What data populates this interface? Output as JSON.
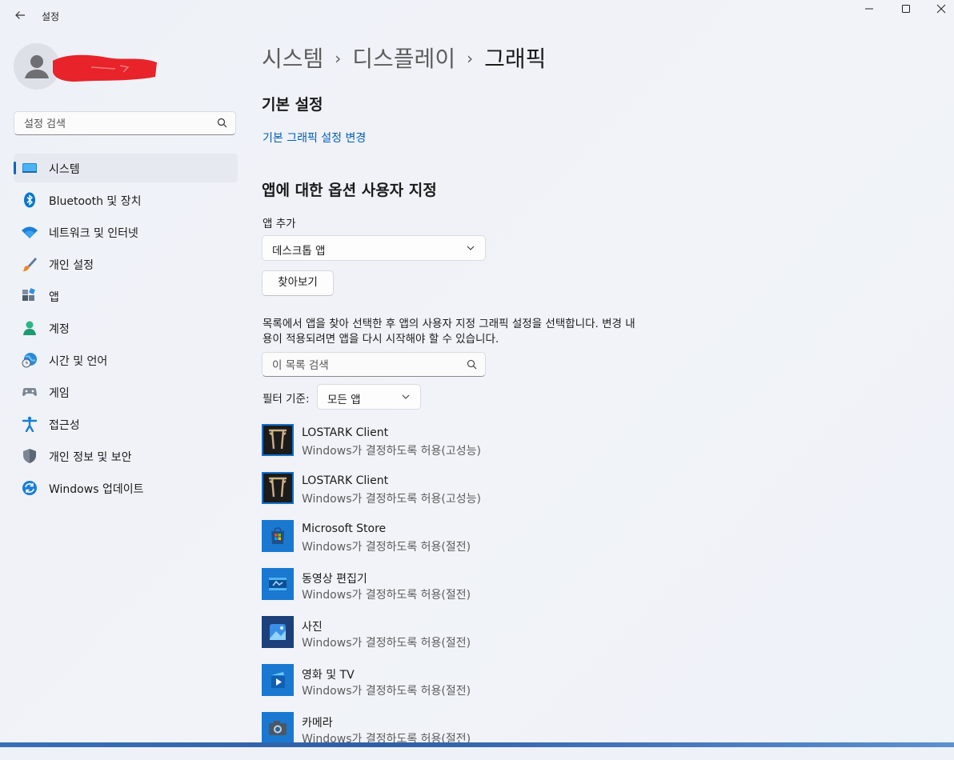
{
  "window": {
    "title": "설정",
    "back_icon": "back-arrow-icon",
    "controls": [
      "minimize-icon",
      "maximize-icon",
      "close-icon"
    ]
  },
  "search": {
    "placeholder": "설정 검색",
    "icon": "search-icon"
  },
  "sidebar": {
    "items": [
      {
        "label": "시스템",
        "icon": "monitor-icon",
        "active": true
      },
      {
        "label": "Bluetooth 및 장치",
        "icon": "bluetooth-icon",
        "active": false
      },
      {
        "label": "네트워크 및 인터넷",
        "icon": "wifi-icon",
        "active": false
      },
      {
        "label": "개인 설정",
        "icon": "brush-icon",
        "active": false
      },
      {
        "label": "앱",
        "icon": "apps-icon",
        "active": false
      },
      {
        "label": "계정",
        "icon": "person-icon",
        "active": false
      },
      {
        "label": "시간 및 언어",
        "icon": "globe-clock-icon",
        "active": false
      },
      {
        "label": "게임",
        "icon": "gamepad-icon",
        "active": false
      },
      {
        "label": "접근성",
        "icon": "accessibility-icon",
        "active": false
      },
      {
        "label": "개인 정보 및 보안",
        "icon": "shield-icon",
        "active": false
      },
      {
        "label": "Windows 업데이트",
        "icon": "update-icon",
        "active": false
      }
    ]
  },
  "breadcrumb": {
    "part1": "시스템",
    "part2": "디스플레이",
    "current": "그래픽",
    "separator": "›"
  },
  "main": {
    "basic_heading": "기본 설정",
    "basic_link": "기본 그래픽 설정 변경",
    "custom_heading": "앱에 대한 옵션 사용자 지정",
    "add_app_label": "앱 추가",
    "app_type_value": "데스크톱 앱",
    "browse_button": "찾아보기",
    "description": "목록에서 앱을 찾아 선택한 후 앱의 사용자 지정 그래픽 설정을 선택합니다. 변경 내용이 적용되려면 앱을 다시 시작해야 할 수 있습니다.",
    "list_search_placeholder": "이 목록 검색",
    "filter_label": "필터 기준:",
    "filter_value": "모든 앱"
  },
  "apps": [
    {
      "name": "LOSTARK Client",
      "pref": "Windows가 결정하도록 허용(고성능)",
      "icon": "lostark-icon"
    },
    {
      "name": "LOSTARK Client",
      "pref": "Windows가 결정하도록 허용(고성능)",
      "icon": "lostark-icon"
    },
    {
      "name": "Microsoft Store",
      "pref": "Windows가 결정하도록 허용(절전)",
      "icon": "microsoft-store-icon"
    },
    {
      "name": "동영상 편집기",
      "pref": "Windows가 결정하도록 허용(절전)",
      "icon": "video-editor-icon"
    },
    {
      "name": "사진",
      "pref": "Windows가 결정하도록 허용(절전)",
      "icon": "photos-icon"
    },
    {
      "name": "영화 및 TV",
      "pref": "Windows가 결정하도록 허용(절전)",
      "icon": "movies-tv-icon"
    },
    {
      "name": "카메라",
      "pref": "Windows가 결정하도록 허용(절전)",
      "icon": "camera-icon"
    }
  ],
  "colors": {
    "accent": "#0067c0",
    "link": "#005fb8",
    "redaction": "#e8232a"
  }
}
